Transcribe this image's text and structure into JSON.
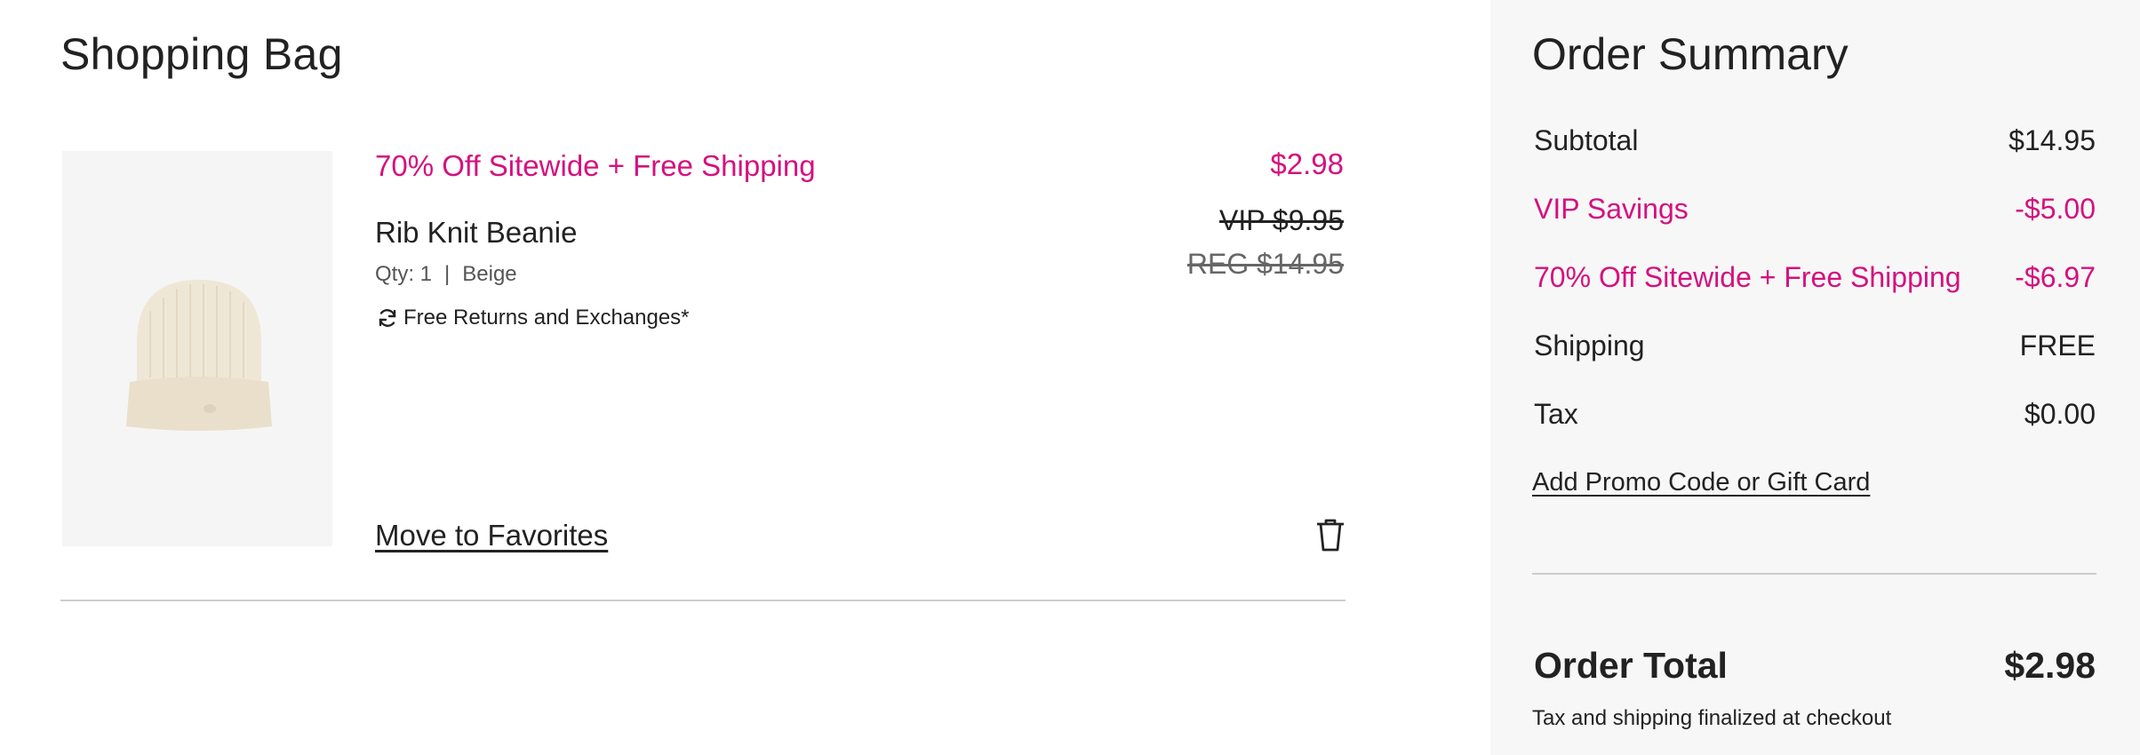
{
  "bag": {
    "title": "Shopping Bag",
    "item": {
      "image_icon": "beanie-image",
      "promo": "70% Off Sitewide + Free Shipping",
      "name": "Rib Knit Beanie",
      "qty": "Qty: 1",
      "separator": "|",
      "color": "Beige",
      "returns": "Free Returns and Exchanges*",
      "returns_icon": "refresh-icon",
      "price_sale": "$2.98",
      "price_vip": "VIP $9.95",
      "price_reg": "REG $14.95",
      "move_to_favorites": "Move to Favorites",
      "delete_icon": "trash-icon"
    }
  },
  "summary": {
    "title": "Order Summary",
    "rows": [
      {
        "label": "Subtotal",
        "value": "$14.95"
      },
      {
        "label": "VIP Savings",
        "value": "-$5.00"
      },
      {
        "label": "70% Off Sitewide + Free Shipping",
        "value": "-$6.97"
      },
      {
        "label": "Shipping",
        "value": "FREE"
      },
      {
        "label": "Tax",
        "value": "$0.00"
      }
    ],
    "promo_link": "Add Promo Code or Gift Card",
    "total_label": "Order Total",
    "total_value": "$2.98",
    "note": "Tax and shipping finalized at checkout"
  },
  "colors": {
    "accent": "#d4117f",
    "text": "#222222",
    "muted": "#666666",
    "summary_bg": "#f7f7f7"
  }
}
